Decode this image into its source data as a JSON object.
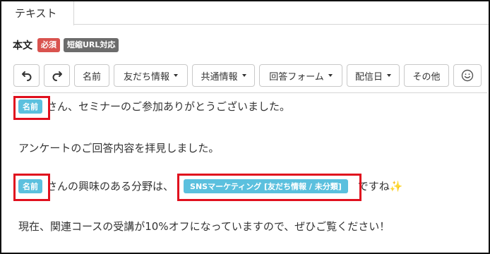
{
  "tab": {
    "label": "テキスト"
  },
  "field": {
    "title": "本文",
    "required_badge": "必須",
    "url_badge": "短縮URL対応"
  },
  "toolbar": {
    "undo_icon": "undo-icon",
    "redo_icon": "redo-icon",
    "name_label": "名前",
    "friend_info_label": "友だち情報",
    "shared_info_label": "共通情報",
    "answer_form_label": "回答フォーム",
    "delivery_date_label": "配信日",
    "other_label": "その他",
    "emoji_icon": "smiley-icon"
  },
  "message": {
    "line1_tag": "名前",
    "line1_text": "さん、セミナーのご参加ありがとうございました。",
    "line2_text": "アンケートのご回答内容を拝見しました。",
    "line3_tag": "名前",
    "line3_text_a": "さんの興味のある分野は、",
    "line3_var": "SNSマーケティング [友だち情報 / 未分類]",
    "line3_text_b": "ですね",
    "line3_emoji": "✨",
    "line4_text": "現在、関連コースの受講が10%オフになっていますので、ぜひご覧ください！"
  },
  "colors": {
    "highlight": "#e0101e",
    "tag_bg": "#5bc0de",
    "required_badge": "#d9534f",
    "url_badge": "#6c6c6c"
  }
}
